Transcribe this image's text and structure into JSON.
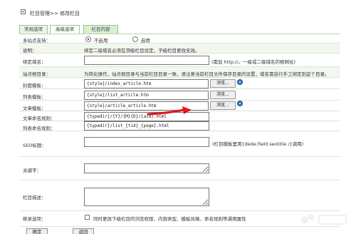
{
  "breadcrumb": {
    "parent": "栏目管理>>",
    "current": "修改栏目"
  },
  "tabs": [
    {
      "label": "常规选项",
      "active": false
    },
    {
      "label": "高级选项",
      "active": true
    },
    {
      "label": "栏目内容",
      "active": false
    }
  ],
  "rows": {
    "multi_site": {
      "label": "多站点支持：",
      "option_off": "不启用",
      "option_on": "启用",
      "selected": "不启用"
    },
    "note": {
      "label": "说明：",
      "text": "绑定二级域名必须在顶级栏目设定，子级栏目更改无效。"
    },
    "bind_domain": {
      "label": "绑定域名：",
      "value": "",
      "hint": "(需加 http://，一级或二级域名的根网址)"
    },
    "site_root": {
      "label": "站点根目录：",
      "text": "为简化操作，站点根目录与当前栏目目录一致，请注意当前栏目文件保存目录的设置，域名需自行手工绑定到这个目录。"
    },
    "index_tpl": {
      "label": "封面模板：",
      "value": "{style}/index_article.htm",
      "button": "浏览..."
    },
    "list_tpl": {
      "label": "列表模板：",
      "value": "{style}/list_article.htm",
      "button": "浏览..."
    },
    "article_tpl": {
      "label": "文章模板：",
      "value": "{style}/article_article.htm",
      "button": "浏览..."
    },
    "article_rule": {
      "label": "文章命名规则：",
      "value": "{typedir}/{Y}/{M}{D}/{aid}.html"
    },
    "list_rule": {
      "label": "列表命名规则：",
      "value": "{typedir}/list_{tid}_{page}.html"
    },
    "seo_title": {
      "label": "SEO标题：",
      "value": "",
      "hint": "(栏目模板里用{dede:field.seotitle /}调用)"
    },
    "keywords": {
      "label": "关键字："
    },
    "description": {
      "label": "栏目描述："
    },
    "inherit": {
      "label": "继承选项：",
      "text": "同时更改下级栏目的浏览权限、内容类型、模板风格、命名规则等通用属性"
    }
  },
  "buttons": {
    "submit": "确定",
    "back": "返回"
  },
  "colors": {
    "tab_border": "#9cc29b",
    "row_shade": "#f2f8f0",
    "arrow": "#e0141e",
    "help_icon": "#3a73c6"
  }
}
